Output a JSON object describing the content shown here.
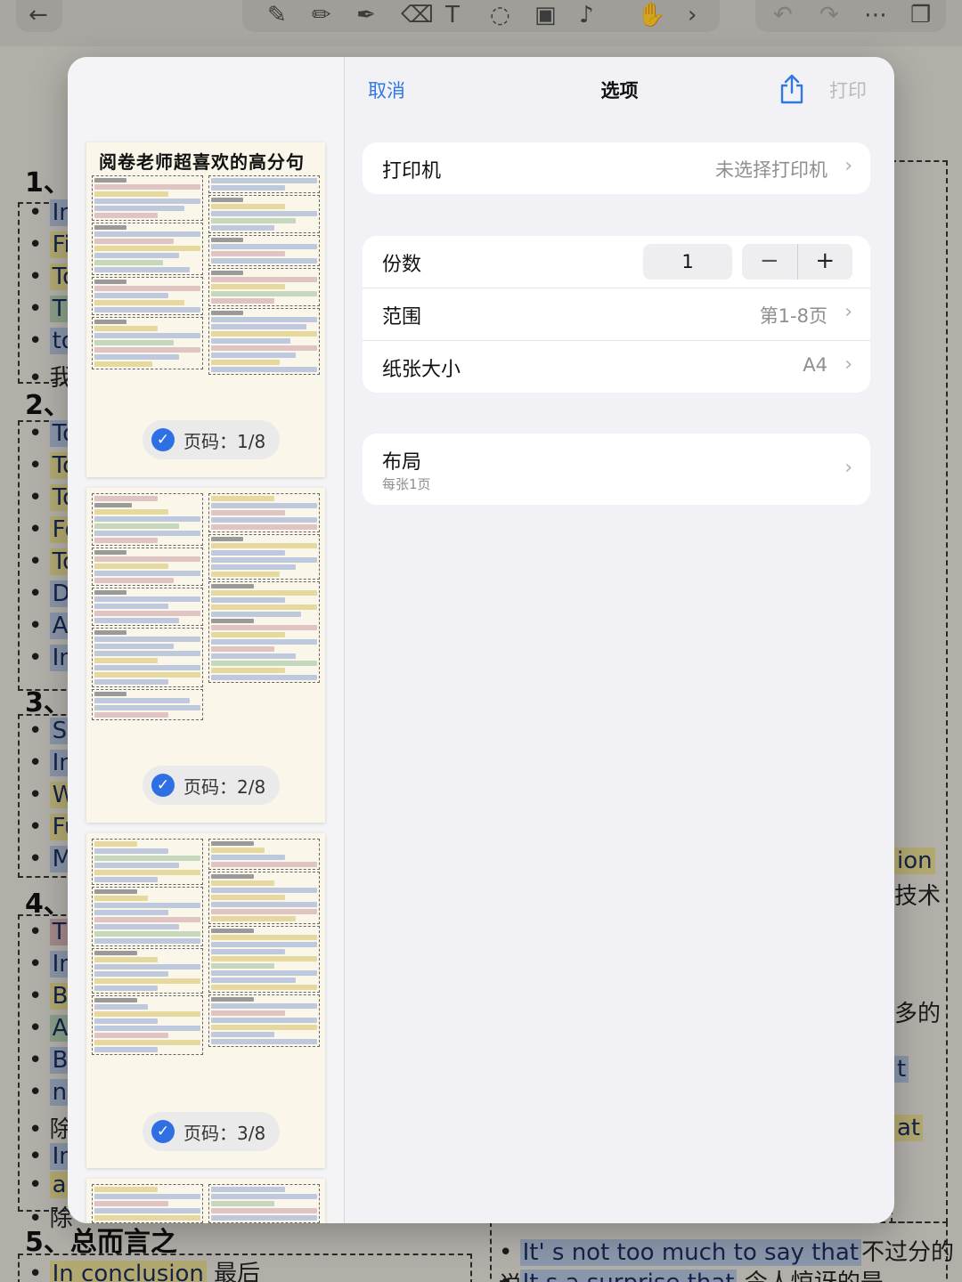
{
  "background": {
    "headings": [
      "1、",
      "2、",
      "3、",
      "4、",
      "5、总而言之"
    ],
    "chips": [
      "In",
      "Fi",
      "To",
      "Th",
      "to",
      "我",
      "To",
      "To",
      "To",
      "Fo",
      "To",
      "Di",
      "As",
      "In",
      "Se",
      "In",
      "Wl",
      "Fu",
      "Mc",
      "Th",
      "In",
      "Be",
      "Ac",
      "Be",
      "ne",
      "除",
      "In",
      "ab",
      "除"
    ],
    "right_fragments": [
      "ion",
      "技术",
      "多的",
      "t",
      "at"
    ],
    "bottom_left": {
      "phrase": "In conclusion",
      "suffix": "最后"
    },
    "bottom_right": {
      "phrase": "It' s not too much to say that",
      "suffix": "不过分的说"
    },
    "bottom_right2": {
      "phrase": "It s a surprise that",
      "suffix": "令人惊讶的是"
    }
  },
  "dialog": {
    "cancel": "取消",
    "title": "选项",
    "share_icon": "share-icon",
    "print": "打印",
    "printer": {
      "label": "打印机",
      "value": "未选择打印机"
    },
    "copies": {
      "label": "份数",
      "value": "1",
      "minus": "−",
      "plus": "+"
    },
    "range": {
      "label": "范围",
      "value": "第1-8页"
    },
    "paper": {
      "label": "纸张大小",
      "value": "A4"
    },
    "layout": {
      "label": "布局",
      "sub": "每张1页"
    },
    "chevron": "›"
  },
  "preview": {
    "page1_title": "阅卷老师超喜欢的高分句",
    "badges": [
      "页码：1/8",
      "页码：2/8",
      "页码：3/8"
    ],
    "check_icon": "checkmark-circle-icon"
  },
  "colors": {
    "accent": "#2f78e0",
    "check": "#2f6fe4",
    "disabled": "#b9b9bd"
  }
}
